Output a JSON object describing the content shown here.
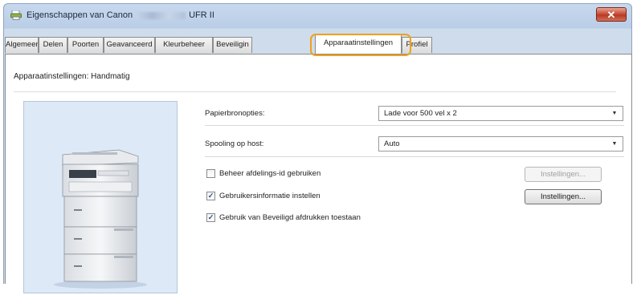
{
  "window": {
    "title_prefix": "Eigenschappen van Canon",
    "title_suffix": "UFR II",
    "close_glyph": "✕"
  },
  "tabs": [
    {
      "label": "Algemeen",
      "active": false
    },
    {
      "label": "Delen",
      "active": false
    },
    {
      "label": "Poorten",
      "active": false
    },
    {
      "label": "Geavanceerd",
      "active": false
    },
    {
      "label": "Kleurbeheer",
      "active": false
    },
    {
      "label": "Beveiligin",
      "active": false
    },
    {
      "label": "Apparaatinstellingen",
      "active": true
    },
    {
      "label": "Profiel",
      "active": false
    }
  ],
  "panel": {
    "mode_label": "Apparaatinstellingen: Handmatig",
    "paper_source": {
      "label": "Papierbronopties:",
      "value": "Lade voor 500 vel x 2"
    },
    "spooling": {
      "label": "Spooling op host:",
      "value": "Auto"
    },
    "checkboxes": [
      {
        "label": "Beheer afdelings-id gebruiken",
        "checked": false
      },
      {
        "label": "Gebruikersinformatie instellen",
        "checked": true
      },
      {
        "label": "Gebruik van Beveiligd afdrukken toestaan",
        "checked": true
      }
    ],
    "buttons": [
      {
        "label": "Instellingen...",
        "enabled": false
      },
      {
        "label": "Instellingen...",
        "enabled": true
      }
    ]
  },
  "colors": {
    "highlight": "#f0a11c",
    "titlebar": "#b9cde6",
    "preview_bg": "#dde9f7"
  },
  "icons": {
    "close": "close-icon",
    "chevron": "chevron-down-icon",
    "check": "checkmark-icon",
    "app": "printer-icon"
  }
}
